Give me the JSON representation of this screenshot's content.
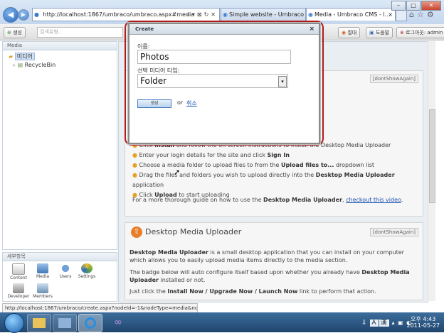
{
  "browser": {
    "back_icon": "back-arrow-icon",
    "forward_icon": "forward-arrow-icon",
    "address": "http://localhost:1867/umbraco/umbraco.aspx#media",
    "tabs": [
      {
        "label": "Simple website - Umbraco C..."
      },
      {
        "label": "Media - Umbraco CMS - l..."
      }
    ],
    "status": "http://localhost:1867/umbraco/create.aspx?nodeId=-1&nodeType=media&no..."
  },
  "umbraco_header": {
    "search_placeholder": "검색유형..",
    "buttons": [
      {
        "label": "절대"
      },
      {
        "label": "도움말"
      },
      {
        "label": "로그아웃: admin"
      }
    ]
  },
  "tree": {
    "title": "Media",
    "items": [
      {
        "label": "미디어"
      },
      {
        "label": "RecycleBin"
      }
    ]
  },
  "sections": {
    "title": "세부항목",
    "items": [
      {
        "label": "Content"
      },
      {
        "label": "Media"
      },
      {
        "label": "Users"
      },
      {
        "label": "Settings"
      },
      {
        "label": "Developer"
      },
      {
        "label": "Members"
      }
    ]
  },
  "content": {
    "dont_show_again": "[dontShowAgain]",
    "steps": [
      {
        "pre": "Click ",
        "bold": "Install",
        "post": " and follow the on screen instructions to install the Desktop Media Uploader"
      },
      {
        "pre": "Enter your login details for the site and click ",
        "bold": "Sign In",
        "post": ""
      },
      {
        "pre": "Choose a media folder to upload files to from the ",
        "bold": "Upload files to...",
        "post": " dropdown list"
      },
      {
        "pre": "Drag the files and folders you wish to upload directly into the ",
        "bold": "Desktop Media Uploader",
        "post": " application"
      },
      {
        "pre": "Click ",
        "bold": "Upload",
        "post": " to start uploading"
      }
    ],
    "guide_pre": "For a more thorough guide on how to use the ",
    "guide_bold": "Desktop Media Uploader",
    "guide_mid": ", ",
    "guide_link": "checkout this video",
    "guide_post": ".",
    "box2_title": "Desktop Media Uploader",
    "box2_p1_bold": "Desktop Media Uploader",
    "box2_p1": " is a small desktop application that you can install on your computer which allows you to easily upload media items directly to the media section.",
    "box2_p2_pre": "The badge below will auto configure itself based upon whether you already have ",
    "box2_p2_bold": "Desktop Media Uploader",
    "box2_p2_post": " installed or not.",
    "box2_p3_pre": "Just click the ",
    "box2_p3_bold": "Install Now / Upgrade Now / Launch Now",
    "box2_p3_post": " link to perform that action."
  },
  "modal": {
    "title": "Create",
    "close": "×",
    "name_label": "이름:",
    "name_value": "Photos",
    "type_label": "선택 미디어 타입:",
    "type_value": "Folder",
    "create_button": "생성",
    "or": "or",
    "cancel_link": "취소"
  },
  "taskbar": {
    "tray_lang": "A",
    "tray_ime": "漢",
    "time": "오후 4:43",
    "date": "2011-05-27"
  }
}
